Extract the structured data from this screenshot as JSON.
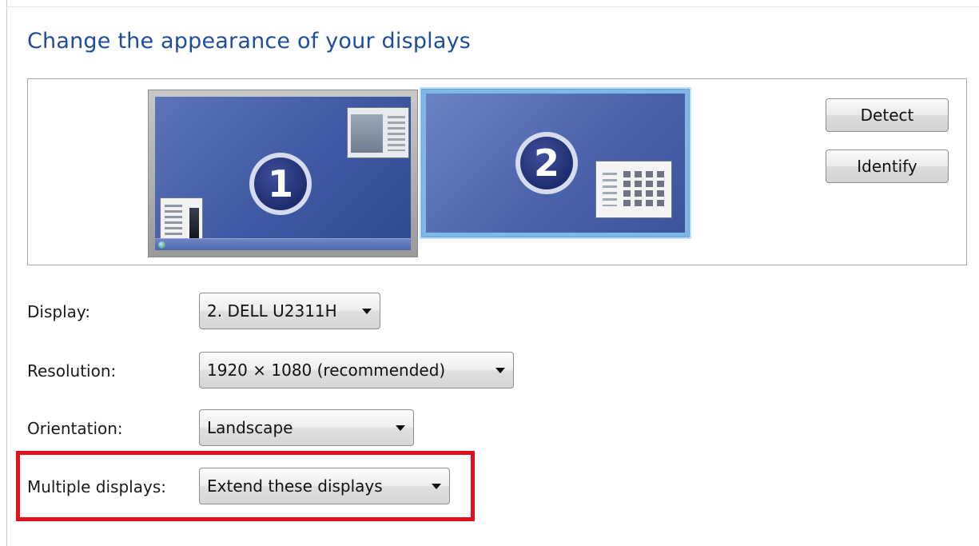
{
  "header": {
    "title": "Change the appearance of your displays"
  },
  "monitors": [
    {
      "number": "1",
      "selected": false
    },
    {
      "number": "2",
      "selected": true
    }
  ],
  "buttons": {
    "detect": "Detect",
    "identify": "Identify"
  },
  "settings": {
    "display": {
      "label": "Display:",
      "value": "2. DELL U2311H"
    },
    "resolution": {
      "label": "Resolution:",
      "value": "1920 × 1080 (recommended)"
    },
    "orientation": {
      "label": "Orientation:",
      "value": "Landscape"
    },
    "multiple_displays": {
      "label": "Multiple displays:",
      "value": "Extend these displays"
    }
  },
  "colors": {
    "title_blue": "#1e4d99",
    "highlight_red": "#e0121b",
    "selected_monitor_border": "#7fb8e6"
  }
}
